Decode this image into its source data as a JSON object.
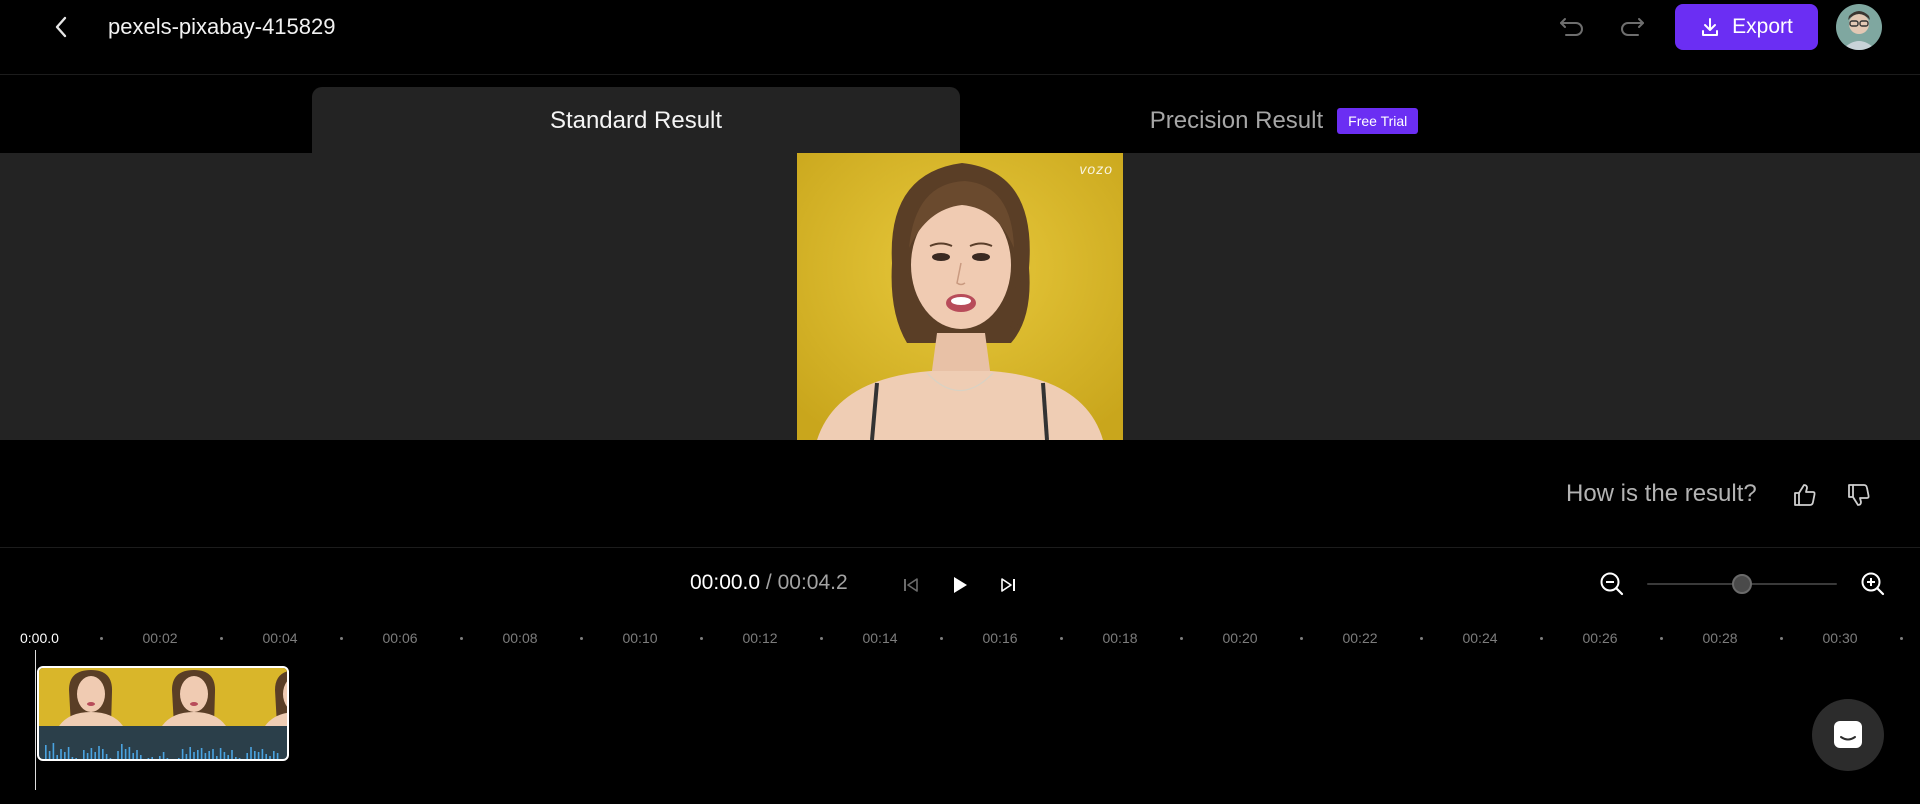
{
  "header": {
    "title": "pexels-pixabay-415829",
    "export_label": "Export"
  },
  "tabs": {
    "standard": "Standard Result",
    "precision": "Precision Result",
    "precision_badge": "Free Trial"
  },
  "preview": {
    "watermark": "vozo"
  },
  "feedback": {
    "question": "How is the result?"
  },
  "playback": {
    "current_time": "00:00.0",
    "separator": " / ",
    "total_time": "00:04.2",
    "zoom_level": 0.5
  },
  "timeline": {
    "start_label": "0:00.0",
    "ticks": [
      "00:02",
      "00:04",
      "00:06",
      "00:08",
      "00:10",
      "00:12",
      "00:14",
      "00:16",
      "00:18",
      "00:20",
      "00:22",
      "00:24",
      "00:26",
      "00:28",
      "00:30"
    ]
  },
  "colors": {
    "accent": "#6b2ef3",
    "preview_bg": "#232323",
    "video_bg": "#d9b62a",
    "waveform": "#4aa3e0"
  },
  "icons": {
    "back": "chevron-left-icon",
    "undo": "undo-icon",
    "redo": "redo-icon",
    "export": "download-icon",
    "thumbs_up": "thumbs-up-icon",
    "thumbs_down": "thumbs-down-icon",
    "skip_back": "skip-back-icon",
    "play": "play-icon",
    "skip_forward": "skip-forward-icon",
    "zoom_out": "zoom-out-icon",
    "zoom_in": "zoom-in-icon",
    "chat": "chat-icon"
  }
}
